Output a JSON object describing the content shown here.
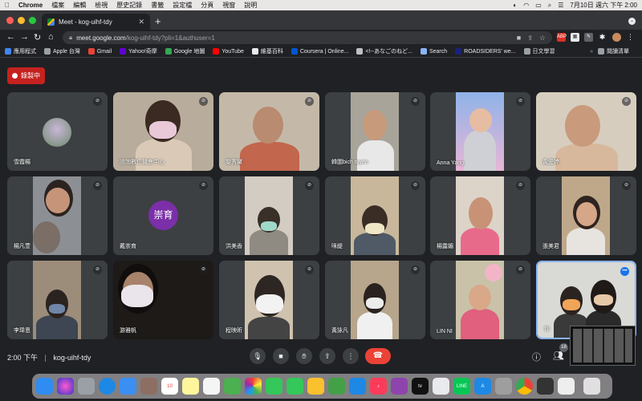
{
  "menubar": {
    "app": "Chrome",
    "items": [
      "檔案",
      "編輯",
      "檢視",
      "歷史記錄",
      "書籤",
      "設定檔",
      "分頁",
      "視窗",
      "說明"
    ],
    "clock": "7月10日 週六 下午 2:00"
  },
  "browser": {
    "tab_title": "Meet - kog-uihf-tdy",
    "url_host": "meet.google.com",
    "url_path": "/kog-uihf-tdy?pli=1&authuser=1",
    "bookmarks": [
      "應用程式",
      "Apple 台灣",
      "Gmail",
      "Yahoo!奇摩",
      "Google 地圖",
      "YouTube",
      "維基百科",
      "Coursera | Online...",
      "<!--あなごのねど...",
      "Search",
      "ROADSIDERS' we...",
      "日文學習"
    ],
    "reading_list": "閱讀清單"
  },
  "meet": {
    "record_label": "錄製中",
    "participants": [
      {
        "name": "雪霞楊",
        "avatar": "photo"
      },
      {
        "name": "諮詢數位機會中心",
        "avatar": "video"
      },
      {
        "name": "黎秀黛",
        "avatar": "video"
      },
      {
        "name": "韓圜bich tuyen",
        "avatar": "video"
      },
      {
        "name": "Anna Yang",
        "avatar": "video"
      },
      {
        "name": "黃愛婷",
        "avatar": "video"
      },
      {
        "name": "楊凡萱",
        "avatar": "video"
      },
      {
        "name": "戴崇育",
        "avatar": "initials",
        "initials": "崇育"
      },
      {
        "name": "洪美香",
        "avatar": "video"
      },
      {
        "name": "咪緹",
        "avatar": "video"
      },
      {
        "name": "楊露媚",
        "avatar": "video"
      },
      {
        "name": "張美君",
        "avatar": "video"
      },
      {
        "name": "李瑋恩",
        "avatar": "video"
      },
      {
        "name": "游雅帆",
        "avatar": "video"
      },
      {
        "name": "程映昕",
        "avatar": "video"
      },
      {
        "name": "黃詠凡",
        "avatar": "video"
      },
      {
        "name": "LIN NI",
        "avatar": "video"
      },
      {
        "name": "你",
        "avatar": "video"
      }
    ],
    "time": "2:00 下午",
    "meeting_code": "kog-uihf-tdy",
    "participant_count": "18"
  },
  "colors": {
    "meet_bg": "#202124",
    "tile_bg": "#3c4043",
    "record_red": "#c5221f",
    "end_call_red": "#ea4335",
    "avatar_purple": "#7b2fa8",
    "active_border": "#8ab4f8"
  }
}
